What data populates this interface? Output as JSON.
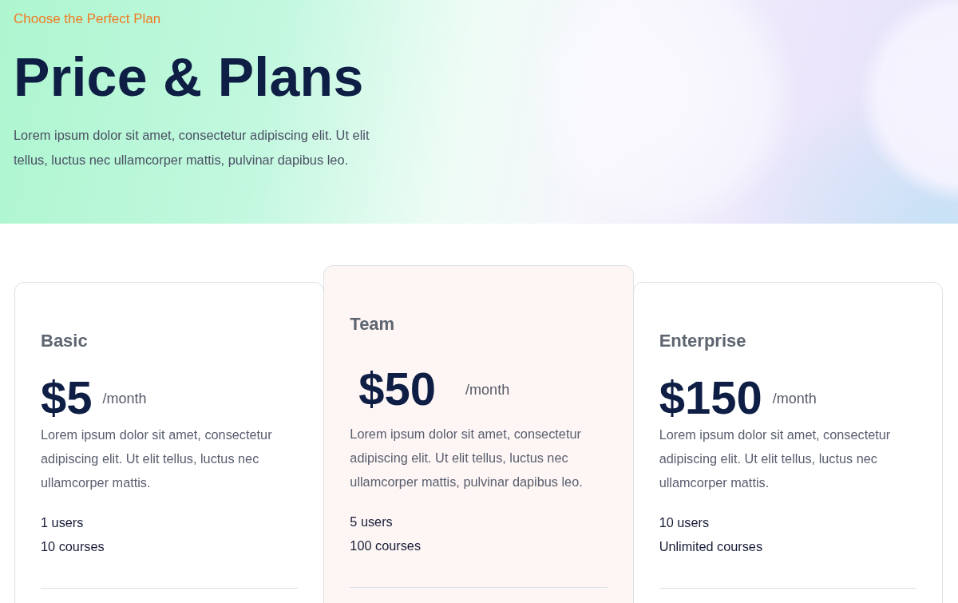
{
  "hero": {
    "eyebrow": "Choose the Perfect Plan",
    "title": "Price & Plans",
    "description": "Lorem ipsum dolor sit amet, consectetur adipiscing elit. Ut elit tellus, luctus nec ullamcorper mattis, pulvinar dapibus leo."
  },
  "plans": [
    {
      "name": "Basic",
      "price": "$5",
      "period": "/month",
      "description": "Lorem ipsum dolor sit amet, consectetur adipiscing elit. Ut elit tellus, luctus nec ullamcorper mattis.",
      "features": [
        "1 users",
        "10 courses"
      ],
      "highlighted": false
    },
    {
      "name": "Team",
      "price": "$50",
      "period": "/month",
      "description": "Lorem ipsum dolor sit amet, consectetur adipiscing elit. Ut elit tellus, luctus nec ullamcorper mattis, pulvinar dapibus leo.",
      "features": [
        "5 users",
        "100 courses"
      ],
      "highlighted": true
    },
    {
      "name": "Enterprise",
      "price": "$150",
      "period": "/month",
      "description": "Lorem ipsum dolor sit amet, consectetur adipiscing elit. Ut elit tellus, luctus nec ullamcorper mattis.",
      "features": [
        "10 users",
        "Unlimited courses"
      ],
      "highlighted": false
    }
  ]
}
